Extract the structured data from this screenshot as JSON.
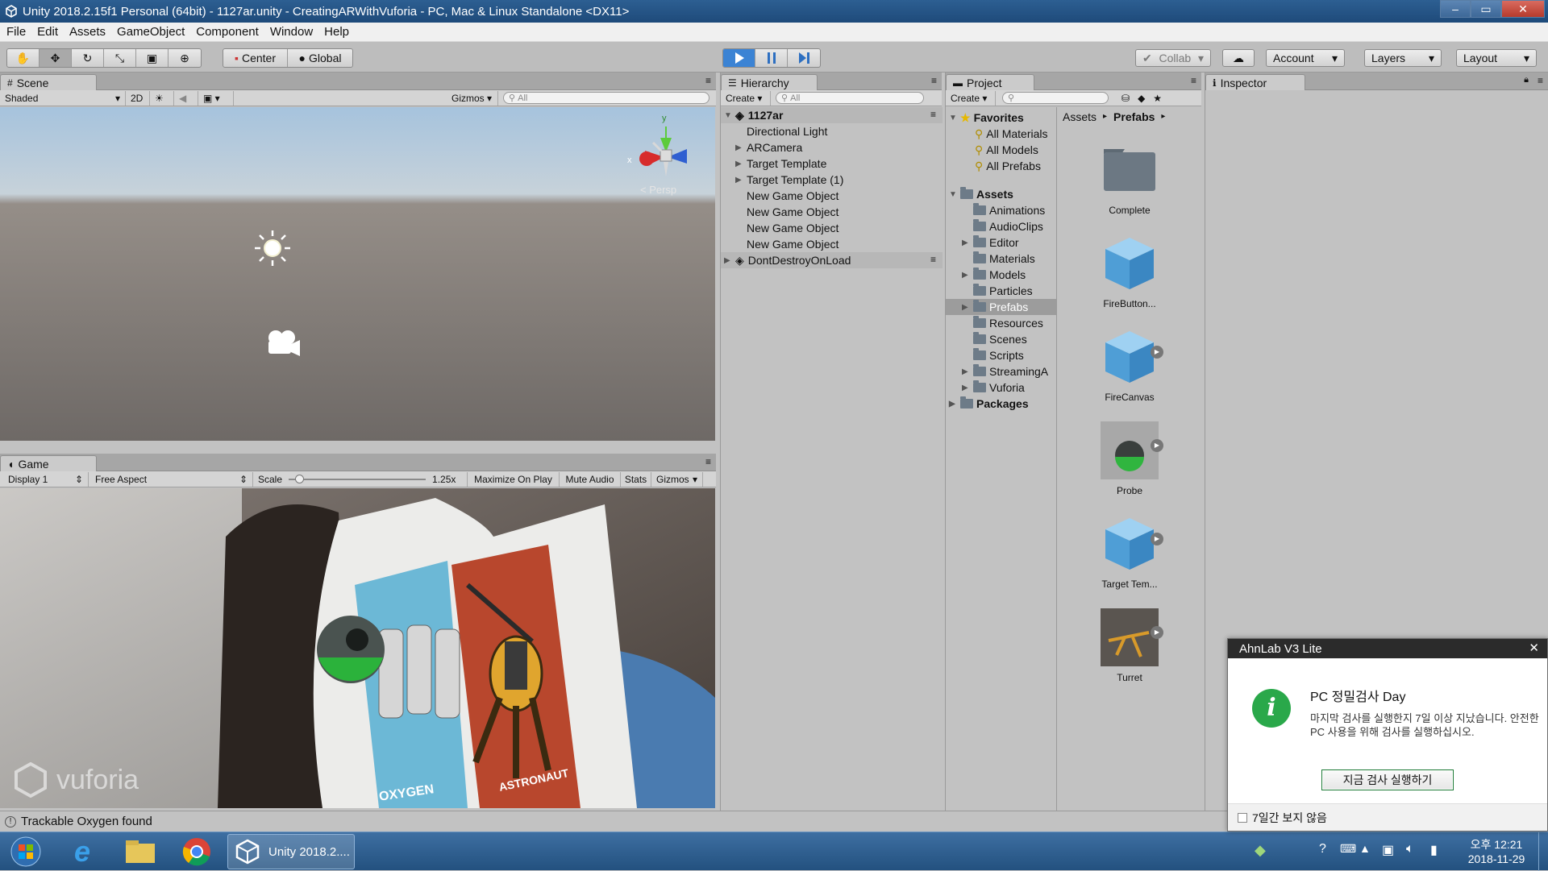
{
  "window": {
    "title": "Unity 2018.2.15f1 Personal (64bit) - 1127ar.unity - CreatingARWithVuforia - PC, Mac & Linux Standalone <DX11>",
    "min": "–",
    "max": "▭",
    "close": "✕"
  },
  "menu": [
    "File",
    "Edit",
    "Assets",
    "GameObject",
    "Component",
    "Window",
    "Help"
  ],
  "toolbar": {
    "pivot": "Center",
    "space": "Global",
    "collab": "Collab",
    "account": "Account",
    "layers": "Layers",
    "layout": "Layout",
    "play_state": "playing"
  },
  "scene": {
    "tab": "Scene",
    "shading": "Shaded",
    "mode2d": "2D",
    "gizmos": "Gizmos",
    "search_placeholder": "All",
    "persp": "< Persp",
    "axis_y": "y",
    "axis_x": "x"
  },
  "game": {
    "tab": "Game",
    "display": "Display 1",
    "aspect": "Free Aspect",
    "scale_label": "Scale",
    "scale_value": "1.25x",
    "scale_fraction": 0.05,
    "maximize": "Maximize On Play",
    "mute": "Mute Audio",
    "stats": "Stats",
    "gizmos": "Gizmos",
    "watermark": "vuforia",
    "card_left": "OXYGEN",
    "card_right": "ASTRONAUT"
  },
  "hierarchy": {
    "tab": "Hierarchy",
    "create": "Create",
    "search_placeholder": "All",
    "scene_name": "1127ar",
    "items": [
      {
        "label": "Directional Light",
        "expandable": false
      },
      {
        "label": "ARCamera",
        "expandable": true
      },
      {
        "label": "Target Template",
        "expandable": true
      },
      {
        "label": "Target Template (1)",
        "expandable": true
      },
      {
        "label": "New Game Object",
        "expandable": false
      },
      {
        "label": "New Game Object",
        "expandable": false
      },
      {
        "label": "New Game Object",
        "expandable": false
      },
      {
        "label": "New Game Object",
        "expandable": false
      }
    ],
    "ddol": "DontDestroyOnLoad"
  },
  "project": {
    "tab": "Project",
    "create": "Create",
    "favorites": {
      "label": "Favorites",
      "items": [
        "All Materials",
        "All Models",
        "All Prefabs"
      ]
    },
    "assets": {
      "label": "Assets",
      "items": [
        {
          "label": "Animations",
          "expandable": false
        },
        {
          "label": "AudioClips",
          "expandable": false
        },
        {
          "label": "Editor",
          "expandable": true
        },
        {
          "label": "Materials",
          "expandable": false
        },
        {
          "label": "Models",
          "expandable": true
        },
        {
          "label": "Particles",
          "expandable": false
        },
        {
          "label": "Prefabs",
          "expandable": true,
          "selected": true
        },
        {
          "label": "Resources",
          "expandable": false
        },
        {
          "label": "Scenes",
          "expandable": false
        },
        {
          "label": "Scripts",
          "expandable": false
        },
        {
          "label": "StreamingA",
          "expandable": true
        },
        {
          "label": "Vuforia",
          "expandable": true
        }
      ]
    },
    "packages": "Packages",
    "breadcrumb": [
      "Assets",
      "Prefabs"
    ],
    "grid": [
      {
        "label": "Complete",
        "kind": "folder"
      },
      {
        "label": "FireButton...",
        "kind": "cube"
      },
      {
        "label": "FireCanvas",
        "kind": "cube-play"
      },
      {
        "label": "Probe",
        "kind": "probe"
      },
      {
        "label": "Target Tem...",
        "kind": "cube-play"
      },
      {
        "label": "Turret",
        "kind": "turret"
      }
    ]
  },
  "inspector": {
    "tab": "Inspector"
  },
  "status": {
    "message": "Trackable Oxygen found"
  },
  "taskbar": {
    "unity_label": "Unity 2018.2....",
    "time": "오후 12:21",
    "date": "2018-11-29"
  },
  "popup": {
    "title": "AhnLab V3 Lite",
    "heading": "PC 정밀검사 Day",
    "body": "마지막 검사를 실행한지 7일 이상 지났습니다. 안전한 PC 사용을 위해 검사를 실행하십시오.",
    "button": "지금 검사 실행하기",
    "checkbox": "7일간 보지 않음",
    "close": "✕"
  }
}
